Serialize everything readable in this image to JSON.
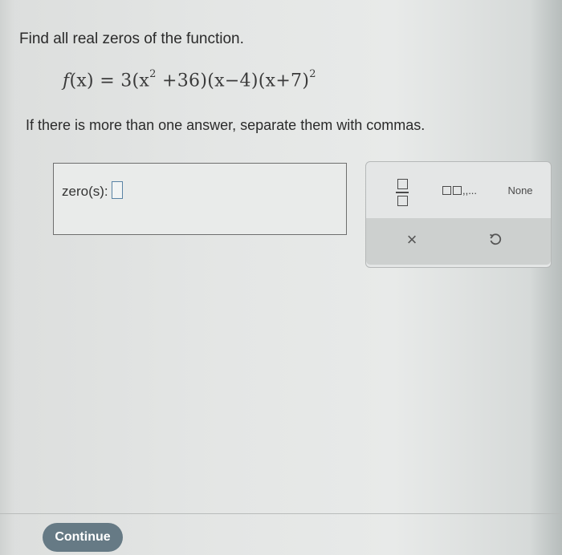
{
  "question": "Find all real zeros of the function.",
  "equation": {
    "lhs": "f",
    "lhs_arg": "(x) = 3",
    "part1": "(x",
    "exp1": "2",
    "part2": " +36)(x−4)(x+7)",
    "exp2": "2"
  },
  "instruction": "If there is more than one answer, separate them with commas.",
  "answer": {
    "label": "zero(s):",
    "value": ""
  },
  "keypad": {
    "list_label": ",,...",
    "none_label": "None",
    "clear_symbol": "×",
    "undo_symbol": "↶"
  },
  "footer": {
    "continue_label": "Continue"
  }
}
